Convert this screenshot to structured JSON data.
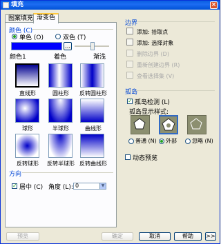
{
  "window": {
    "title": "填充"
  },
  "tabs": [
    {
      "label": "图案填充"
    },
    {
      "label": "渐变色"
    }
  ],
  "color_group": {
    "title": "颜色 (C)",
    "one_color_label": "单色 (O)",
    "two_color_label": "双色 (T)",
    "one_color_selected": true,
    "color_value": "#0000FF",
    "color_label": "颜色1",
    "dark_label": "着色",
    "light_label": "渐浅"
  },
  "patterns": [
    {
      "label": "直线形"
    },
    {
      "label": "圆柱形"
    },
    {
      "label": "反转圆柱形"
    },
    {
      "label": "球形"
    },
    {
      "label": "半球形"
    },
    {
      "label": "曲线形"
    },
    {
      "label": "反转球形"
    },
    {
      "label": "反转半球形"
    },
    {
      "label": "反转曲线形"
    }
  ],
  "orientation": {
    "title": "方向",
    "centered_label": "居中 (C)",
    "centered_checked": true,
    "angle_label": "角度 (L):",
    "angle_value": "0"
  },
  "boundary": {
    "title": "边界",
    "actions": [
      {
        "label": "添加: 拾取点",
        "enabled": true
      },
      {
        "label": "添加: 选择对象",
        "enabled": true
      },
      {
        "label": "删除边界 (D)",
        "enabled": false
      },
      {
        "label": "重新创建边界 (R)",
        "enabled": false
      },
      {
        "label": "查看选择集 (V)",
        "enabled": false
      }
    ]
  },
  "islands": {
    "title": "孤岛",
    "detect_label": "孤岛检测 (L)",
    "detect_checked": true,
    "style_label": "孤岛显示样式:",
    "styles": [
      {
        "label": "普通 (N)",
        "selected": false
      },
      {
        "label": "外部",
        "selected": true
      },
      {
        "label": "忽略 (N)",
        "selected": false
      }
    ]
  },
  "dynamic_preview_label": "动态预览",
  "buttons": {
    "preview": "预览",
    "ok": "确定",
    "cancel": "取消",
    "help": "帮助",
    "more": ">>"
  }
}
